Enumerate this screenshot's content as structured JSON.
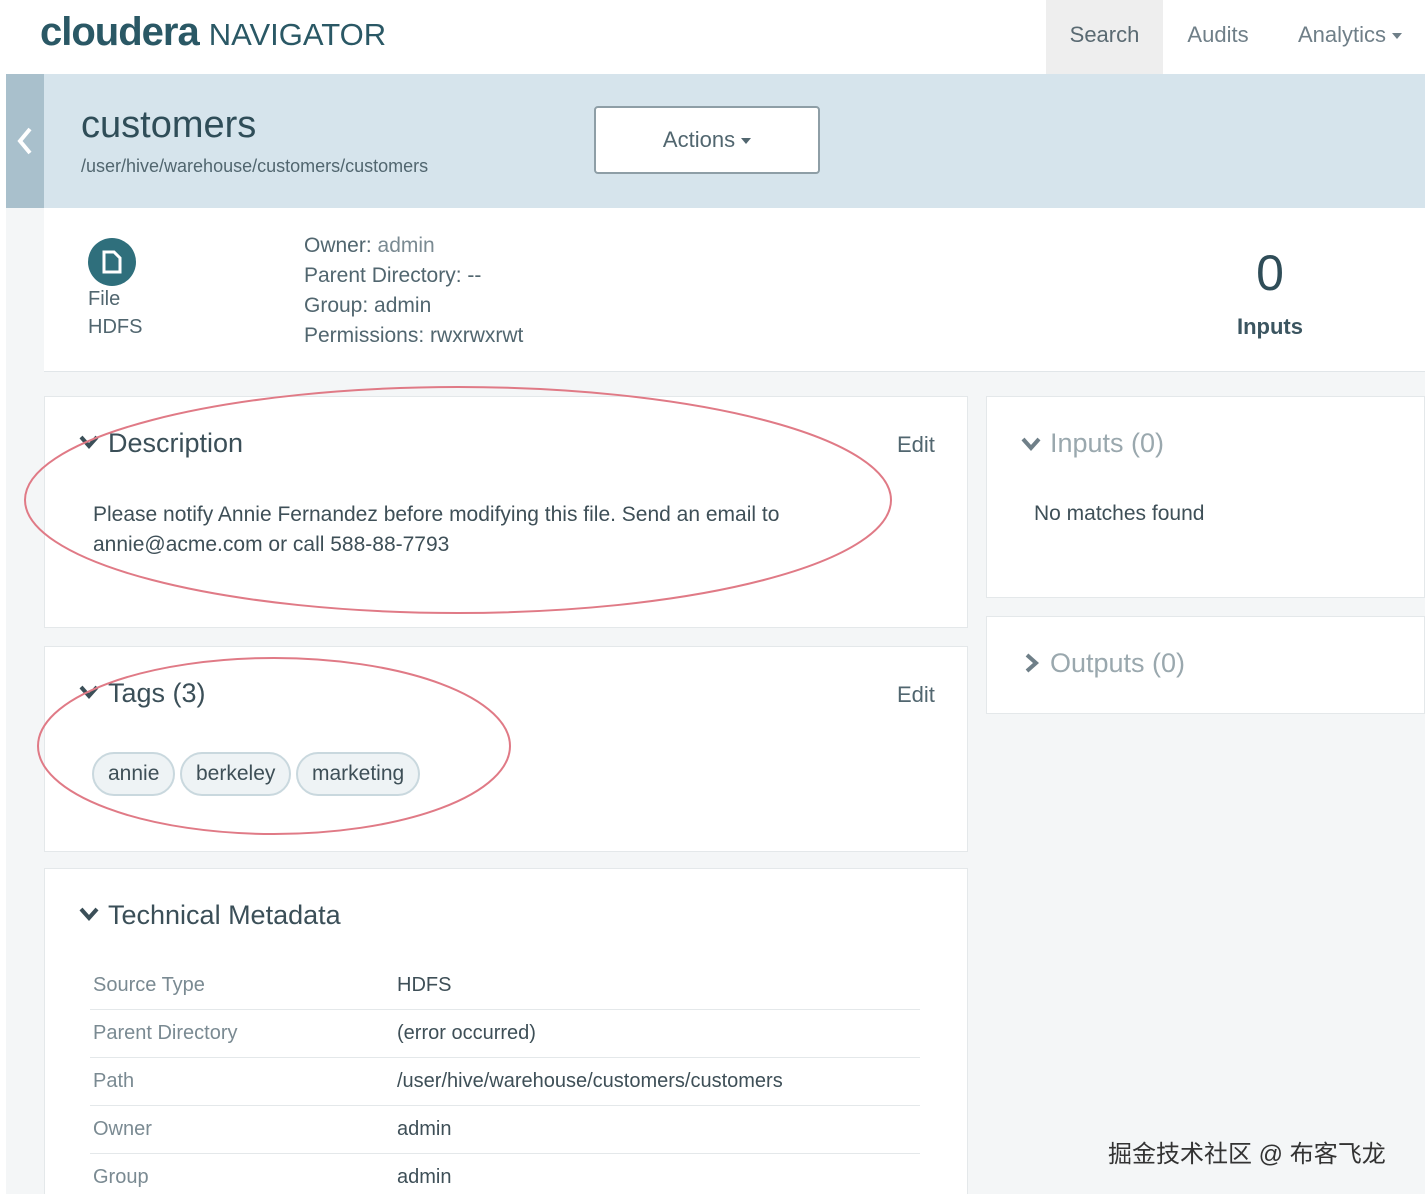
{
  "brand": {
    "logo_main": "cloudera",
    "logo_product": "NAVIGATOR"
  },
  "nav": {
    "search": "Search",
    "audits": "Audits",
    "analytics": "Analytics"
  },
  "entity": {
    "name": "customers",
    "path": "/user/hive/warehouse/customers/customers",
    "actions_label": "Actions",
    "type": "File",
    "source": "HDFS",
    "owner_label": "Owner:",
    "owner": "admin",
    "parent_dir_label": "Parent Directory:",
    "parent_dir": "--",
    "group_label": "Group:",
    "group": "admin",
    "permissions_label": "Permissions:",
    "permissions": "rwxrwxrwt",
    "inputs_count": "0",
    "inputs_label": "Inputs"
  },
  "description": {
    "title": "Description",
    "edit": "Edit",
    "text": "Please notify Annie Fernandez before modifying this file. Send an email to annie@acme.com or call 588-88-7793"
  },
  "tags": {
    "title": "Tags (3)",
    "edit": "Edit",
    "items": [
      "annie",
      "berkeley",
      "marketing"
    ]
  },
  "technical": {
    "title": "Technical Metadata",
    "rows": [
      {
        "key": "Source Type",
        "value": "HDFS"
      },
      {
        "key": "Parent Directory",
        "value": "(error occurred)"
      },
      {
        "key": "Path",
        "value": "/user/hive/warehouse/customers/customers"
      },
      {
        "key": "Owner",
        "value": "admin"
      },
      {
        "key": "Group",
        "value": "admin"
      }
    ]
  },
  "lineage": {
    "inputs_title": "Inputs (0)",
    "inputs_empty": "No matches found",
    "outputs_title": "Outputs (0)"
  },
  "annotation_color": "#e07a86",
  "watermark": "掘金技术社区 @ 布客飞龙"
}
